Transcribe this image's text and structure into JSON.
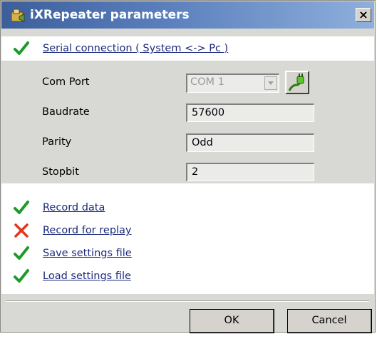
{
  "window": {
    "title": "iXRepeater parameters",
    "close_label": "×",
    "title_color": "#4a6eb0"
  },
  "serial": {
    "status": "ok",
    "label": "Serial connection ( System <-> Pc )"
  },
  "fields": {
    "com_port": {
      "label": "Com Port",
      "value": "COM 1"
    },
    "baudrate": {
      "label": "Baudrate",
      "value": "57600"
    },
    "parity": {
      "label": "Parity",
      "value": "Odd"
    },
    "stopbit": {
      "label": "Stopbit",
      "value": "2"
    }
  },
  "options": [
    {
      "label": "Record data",
      "status": "ok"
    },
    {
      "label": "Record for replay",
      "status": "error"
    },
    {
      "label": "Save settings file",
      "status": "ok"
    },
    {
      "label": "Load settings file",
      "status": "ok"
    }
  ],
  "buttons": {
    "ok_label": "OK",
    "cancel_label": "Cancel"
  },
  "colors": {
    "check": "#1e9a2a",
    "cross": "#e0371e",
    "link": "#1c2a7c"
  }
}
